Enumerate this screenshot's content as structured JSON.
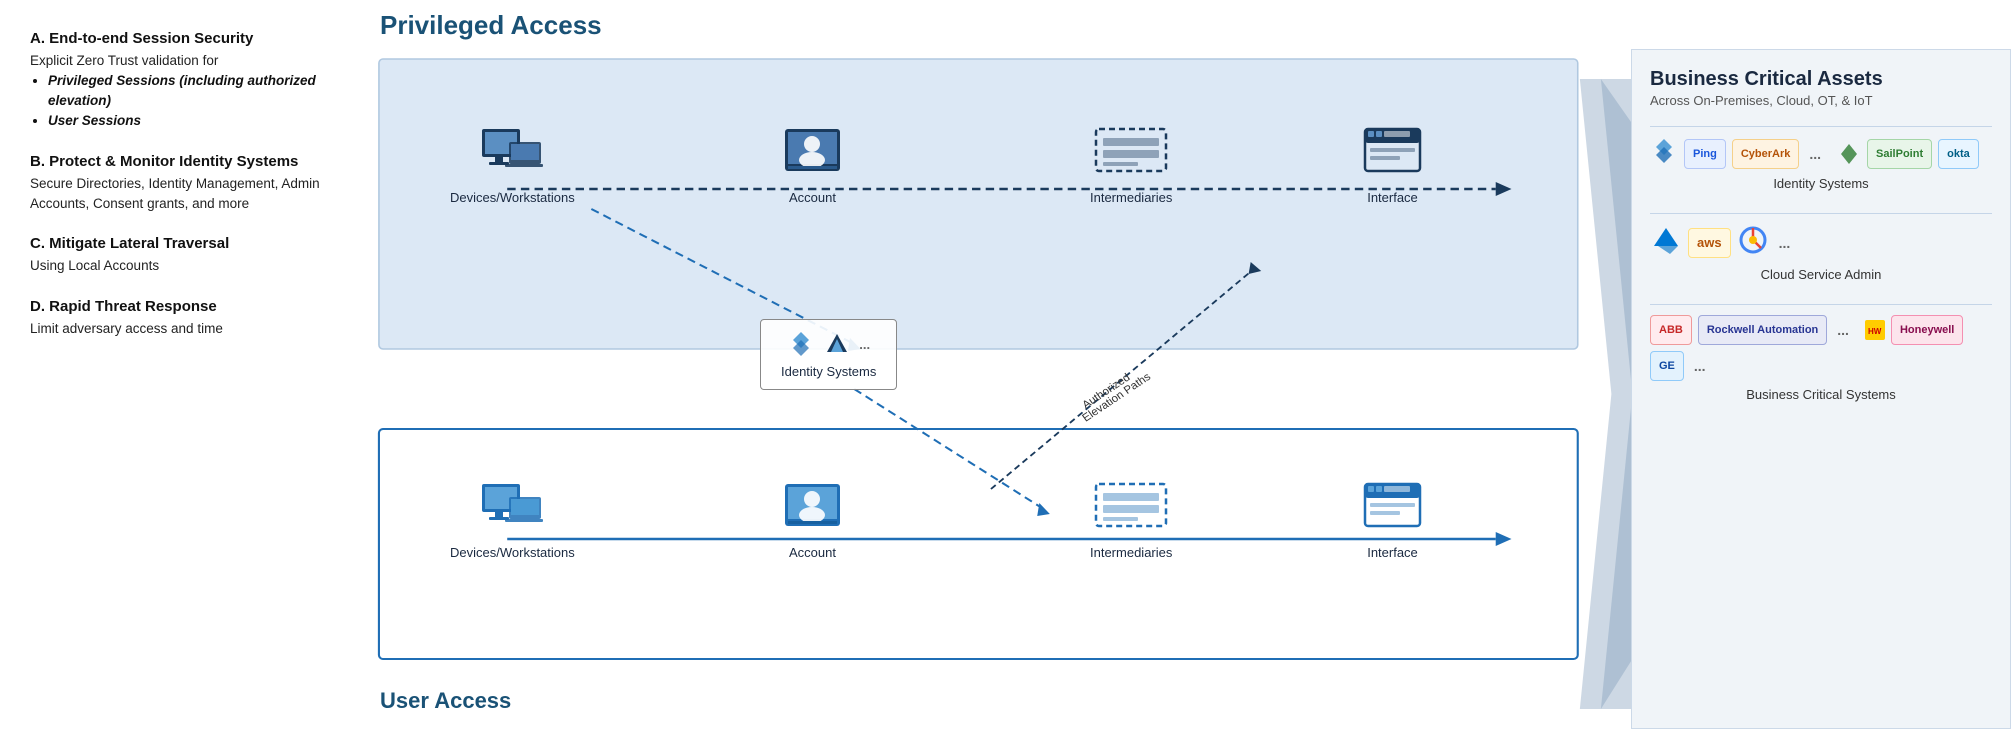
{
  "left_panel": {
    "sections": [
      {
        "id": "A",
        "title": "A. End-to-end Session Security",
        "body": "Explicit Zero Trust validation for",
        "bullets": [
          "Privileged Sessions (including authorized elevation)",
          "User Sessions"
        ]
      },
      {
        "id": "B",
        "title": "B. Protect & Monitor Identity Systems",
        "body": "Secure Directories, Identity Management, Admin Accounts, Consent grants, and more",
        "bullets": []
      },
      {
        "id": "C",
        "title": "C. Mitigate Lateral Traversal",
        "body": "Using Local Accounts",
        "bullets": []
      },
      {
        "id": "D",
        "title": "D. Rapid Threat Response",
        "body": "Limit adversary access and time",
        "bullets": []
      }
    ]
  },
  "diagram": {
    "privileged_access_label": "Privileged Access",
    "user_access_label": "User Access",
    "nodes": {
      "priv_devices": "Devices/Workstations",
      "priv_account": "Account",
      "priv_intermediaries": "Intermediaries",
      "priv_interface": "Interface",
      "identity_systems": "Identity Systems",
      "user_devices": "Devices/Workstations",
      "user_account": "Account",
      "user_intermediaries": "Intermediaries",
      "user_interface": "Interface",
      "authorized_elevation": "Authorized\nElevation Paths"
    }
  },
  "bca": {
    "title": "Business Critical Assets",
    "subtitle": "Across On-Premises, Cloud, OT, & IoT",
    "sections": [
      {
        "label": "Identity Systems",
        "logos": [
          "Ping",
          "CyberArk",
          "SailPoint",
          "okta",
          "..."
        ]
      },
      {
        "label": "Cloud Service Admin",
        "logos": [
          "Azure",
          "aws",
          "GCP",
          "..."
        ]
      },
      {
        "label": "Business Critical Systems",
        "logos": [
          "ABB",
          "Rockwell Automation",
          "Honeywell",
          "GE",
          "..."
        ]
      }
    ]
  },
  "colors": {
    "dark_blue": "#1a3a5c",
    "mid_blue": "#1f6eb5",
    "light_blue": "#5ba3d9",
    "accent_blue": "#2196F3",
    "gray_bg": "#e8ecf0"
  }
}
